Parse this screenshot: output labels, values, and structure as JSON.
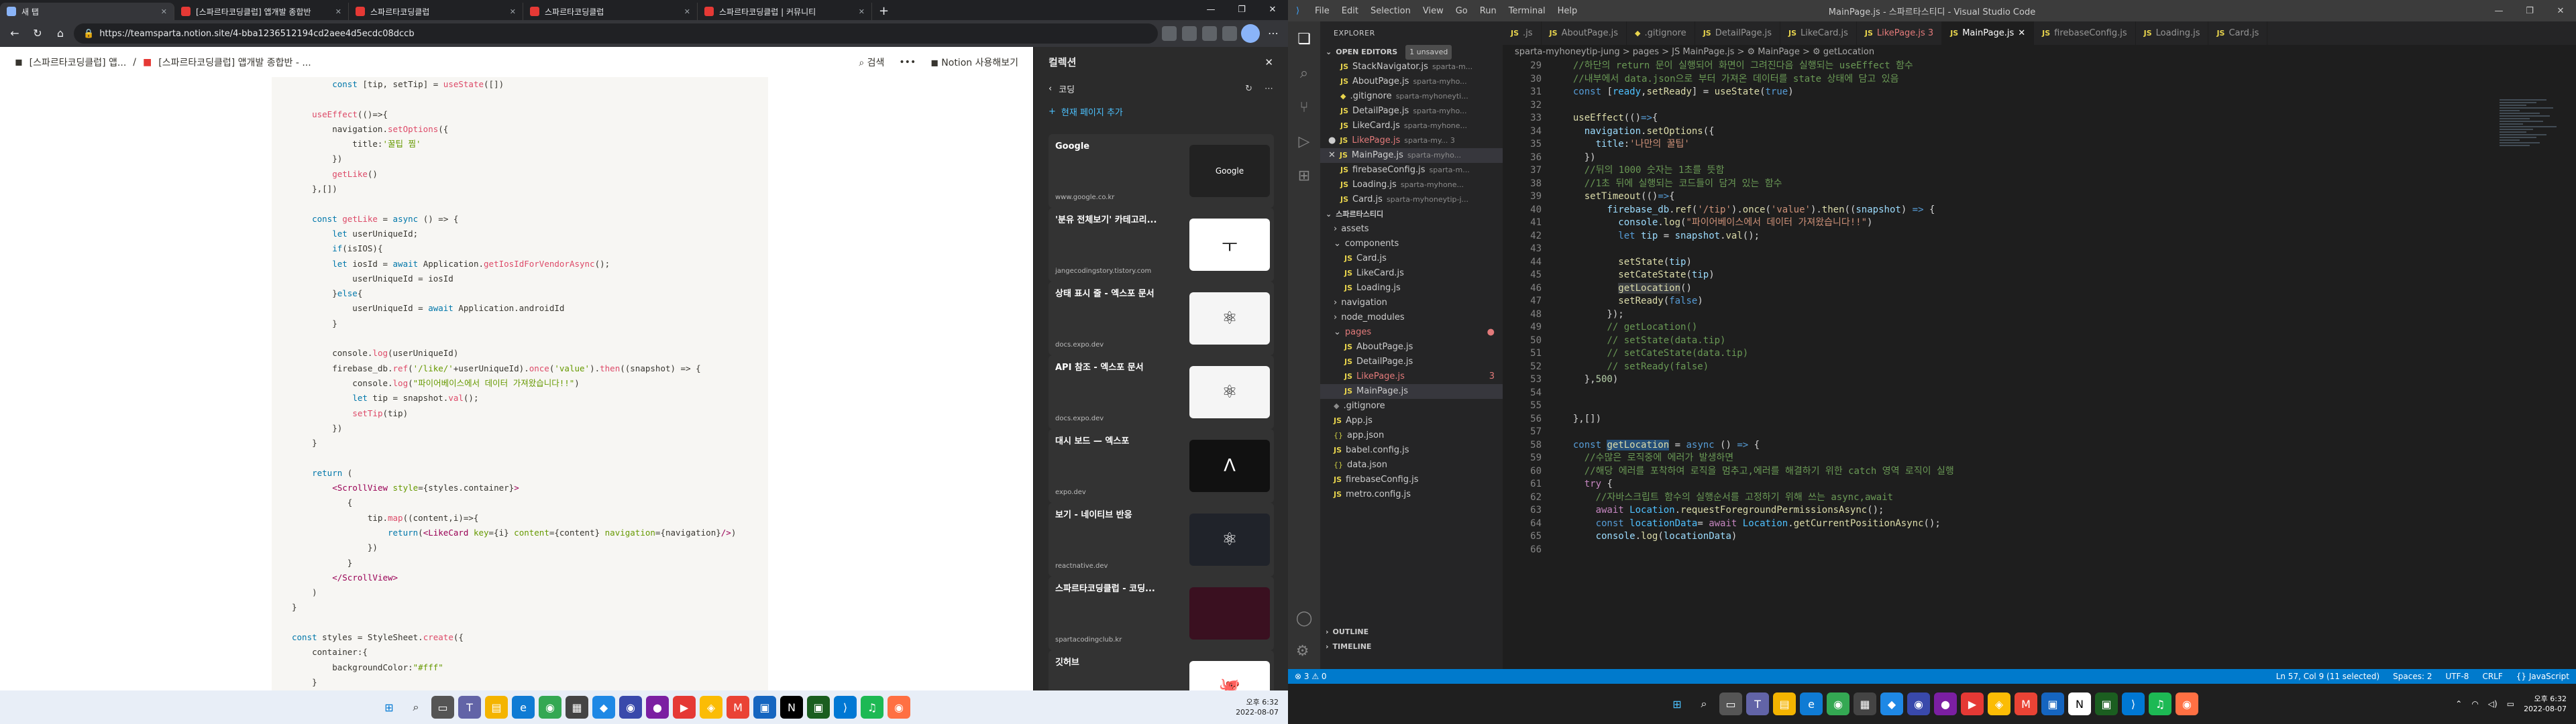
{
  "browser": {
    "tabs": [
      {
        "title": "새 탭",
        "color": "#8ab4f8"
      },
      {
        "title": "[스파르타코딩클럽] 앱개발 종합반",
        "color": "#e53935"
      },
      {
        "title": "스파르타코딩클럽",
        "color": "#e53935"
      },
      {
        "title": "스파르타코딩클럽",
        "color": "#e53935"
      },
      {
        "title": "스파르타코딩클럽 | 커뮤니티",
        "color": "#e53935"
      }
    ],
    "url": "https://teamsparta.notion.site/4-bba1236512194cd2aee4d5ecdc08dccb"
  },
  "notion": {
    "breadcrumb1": "[스파르타코딩클럽] 앱...",
    "breadcrumb2": "[스파르타코딩클럽] 앱개발 종합반 - ...",
    "search": "검색",
    "more": "•••",
    "signup": "Notion 사용해보기"
  },
  "collections": {
    "title": "컬렉션",
    "group": "코딩",
    "add_page": "현재 페이지 추가",
    "items": [
      {
        "title": "Google",
        "url": "www.google.co.kr",
        "thumb_bg": "#222",
        "thumb_icon": "Google"
      },
      {
        "title": "'분유 전체보기' 카테고리...",
        "url": "jangecodingstory.tistory.com",
        "thumb_bg": "#fff",
        "thumb_icon": "ㅜ"
      },
      {
        "title": "상태 표시 줄 - 엑스포 문서",
        "url": "docs.expo.dev",
        "thumb_bg": "#f5f5f5",
        "thumb_icon": "⚛"
      },
      {
        "title": "API 참조 - 엑스포 문서",
        "url": "docs.expo.dev",
        "thumb_bg": "#f5f5f5",
        "thumb_icon": "⚛"
      },
      {
        "title": "대시 보드 — 엑스포",
        "url": "expo.dev",
        "thumb_bg": "#111",
        "thumb_icon": "Λ"
      },
      {
        "title": "보기 - 네이티브 반응",
        "url": "reactnative.dev",
        "thumb_bg": "#20232a",
        "thumb_icon": "⚛"
      },
      {
        "title": "스파르타코딩클럽 - 코딩...",
        "url": "spartacodingclub.kr",
        "thumb_bg": "#3a1020",
        "thumb_icon": ""
      },
      {
        "title": "깃허브",
        "url": "github.com",
        "thumb_bg": "#fff",
        "thumb_icon": "🐙"
      }
    ]
  },
  "taskbar_left": {
    "time": "오후 6:32",
    "date": "2022-08-07"
  },
  "vscode": {
    "menus": [
      "File",
      "Edit",
      "Selection",
      "View",
      "Go",
      "Run",
      "Terminal",
      "Help"
    ],
    "title": "MainPage.js - 스파르타스티디 - Visual Studio Code",
    "explorer_title": "EXPLORER",
    "open_editors": "OPEN EDITORS",
    "unsaved": "1 unsaved",
    "open_files": [
      {
        "name": "StackNavigator.js",
        "path": "sparta-m..."
      },
      {
        "name": "AboutPage.js",
        "path": "sparta-myho..."
      },
      {
        "name": ".gitignore",
        "path": "sparta-myhoneyti..."
      },
      {
        "name": "DetailPage.js",
        "path": "sparta-myho..."
      },
      {
        "name": "LikeCard.js",
        "path": "sparta-myhone..."
      },
      {
        "name": "LikePage.js",
        "path": "sparta-my... 3"
      },
      {
        "name": "MainPage.js",
        "path": "sparta-myho..."
      },
      {
        "name": "firebaseConfig.js",
        "path": "sparta-m..."
      },
      {
        "name": "Loading.js",
        "path": "sparta-myhone..."
      },
      {
        "name": "Card.js",
        "path": "sparta-myhoneytip-j..."
      }
    ],
    "folder": "스파르타스티디",
    "tree": [
      {
        "name": "assets",
        "indent": 1,
        "type": "folder"
      },
      {
        "name": "components",
        "indent": 1,
        "type": "folder-open"
      },
      {
        "name": "Card.js",
        "indent": 2,
        "type": "js"
      },
      {
        "name": "LikeCard.js",
        "indent": 2,
        "type": "js"
      },
      {
        "name": "Loading.js",
        "indent": 2,
        "type": "js"
      },
      {
        "name": "navigation",
        "indent": 1,
        "type": "folder"
      },
      {
        "name": "node_modules",
        "indent": 1,
        "type": "folder"
      },
      {
        "name": "pages",
        "indent": 1,
        "type": "folder-open-mod"
      },
      {
        "name": "AboutPage.js",
        "indent": 2,
        "type": "js"
      },
      {
        "name": "DetailPage.js",
        "indent": 2,
        "type": "js"
      },
      {
        "name": "LikePage.js",
        "indent": 2,
        "type": "js-mod"
      },
      {
        "name": "MainPage.js",
        "indent": 2,
        "type": "js-sel"
      },
      {
        "name": ".gitignore",
        "indent": 1,
        "type": "git"
      },
      {
        "name": "App.js",
        "indent": 1,
        "type": "js"
      },
      {
        "name": "app.json",
        "indent": 1,
        "type": "json"
      },
      {
        "name": "babel.config.js",
        "indent": 1,
        "type": "js"
      },
      {
        "name": "data.json",
        "indent": 1,
        "type": "json"
      },
      {
        "name": "firebaseConfig.js",
        "indent": 1,
        "type": "js"
      },
      {
        "name": "metro.config.js",
        "indent": 1,
        "type": "js"
      }
    ],
    "outline": "OUTLINE",
    "timeline": "TIMELINE",
    "tabs": [
      ".js",
      "AboutPage.js",
      ".gitignore",
      "DetailPage.js",
      "LikeCard.js",
      "LikePage.js 3",
      "MainPage.js",
      "firebaseConfig.js",
      "Loading.js",
      "Card.js"
    ],
    "breadcrumb": "sparta-myhoneytip-jung > pages > JS MainPage.js > ⚙ MainPage > ⚙ getLocation",
    "status_left": "⊗ 3 ⚠ 0",
    "status_right": [
      "Ln 57, Col 9 (11 selected)",
      "Spaces: 2",
      "UTF-8",
      "CRLF",
      "{} JavaScript"
    ]
  },
  "taskbar_right": {
    "time": "오후 6:32",
    "date": "2022-08-07"
  }
}
